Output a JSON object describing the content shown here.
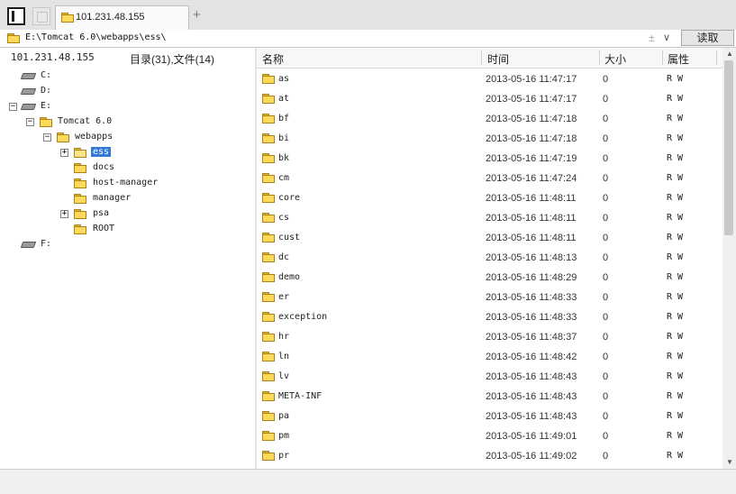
{
  "tabbar": {
    "panel_icon": "panel-toggle-icon",
    "blank_icon": "new-window-icon",
    "active_tab_label": "101.231.48.155",
    "add_tab": "+"
  },
  "address": {
    "path": "E:\\Tomcat 6.0\\webapps\\ess\\",
    "dropdown_glyph": "±",
    "chevron": "∨",
    "read_button": "读取"
  },
  "left": {
    "host": "101.231.48.155",
    "counts": "目录(31),文件(14)",
    "tree": {
      "c": "C:",
      "d": "D:",
      "e": "E:",
      "tomcat": "Tomcat 6.0",
      "webapps": "webapps",
      "ess": "ess",
      "docs": "docs",
      "host_manager": "host-manager",
      "manager": "manager",
      "psa": "psa",
      "root": "ROOT",
      "f": "F:"
    },
    "expand_glyph": "+",
    "collapse_glyph": "−"
  },
  "right": {
    "columns": {
      "name": "名称",
      "time": "时间",
      "size": "大小",
      "attr": "属性"
    },
    "rows": [
      {
        "name": "as",
        "time": "2013-05-16 11:47:17",
        "size": "0",
        "attr": "R W"
      },
      {
        "name": "at",
        "time": "2013-05-16 11:47:17",
        "size": "0",
        "attr": "R W"
      },
      {
        "name": "bf",
        "time": "2013-05-16 11:47:18",
        "size": "0",
        "attr": "R W"
      },
      {
        "name": "bi",
        "time": "2013-05-16 11:47:18",
        "size": "0",
        "attr": "R W"
      },
      {
        "name": "bk",
        "time": "2013-05-16 11:47:19",
        "size": "0",
        "attr": "R W"
      },
      {
        "name": "cm",
        "time": "2013-05-16 11:47:24",
        "size": "0",
        "attr": "R W"
      },
      {
        "name": "core",
        "time": "2013-05-16 11:48:11",
        "size": "0",
        "attr": "R W"
      },
      {
        "name": "cs",
        "time": "2013-05-16 11:48:11",
        "size": "0",
        "attr": "R W"
      },
      {
        "name": "cust",
        "time": "2013-05-16 11:48:11",
        "size": "0",
        "attr": "R W"
      },
      {
        "name": "dc",
        "time": "2013-05-16 11:48:13",
        "size": "0",
        "attr": "R W"
      },
      {
        "name": "demo",
        "time": "2013-05-16 11:48:29",
        "size": "0",
        "attr": "R W"
      },
      {
        "name": "er",
        "time": "2013-05-16 11:48:33",
        "size": "0",
        "attr": "R W"
      },
      {
        "name": "exception",
        "time": "2013-05-16 11:48:33",
        "size": "0",
        "attr": "R W"
      },
      {
        "name": "hr",
        "time": "2013-05-16 11:48:37",
        "size": "0",
        "attr": "R W"
      },
      {
        "name": "ln",
        "time": "2013-05-16 11:48:42",
        "size": "0",
        "attr": "R W"
      },
      {
        "name": "lv",
        "time": "2013-05-16 11:48:43",
        "size": "0",
        "attr": "R W"
      },
      {
        "name": "META-INF",
        "time": "2013-05-16 11:48:43",
        "size": "0",
        "attr": "R W"
      },
      {
        "name": "pa",
        "time": "2013-05-16 11:48:43",
        "size": "0",
        "attr": "R W"
      },
      {
        "name": "pm",
        "time": "2013-05-16 11:49:01",
        "size": "0",
        "attr": "R W"
      },
      {
        "name": "pr",
        "time": "2013-05-16 11:49:02",
        "size": "0",
        "attr": "R W"
      }
    ],
    "scroll_up": "▲",
    "scroll_down": "▼"
  },
  "colors": {
    "selection": "#3478d8",
    "folder": "#ffd95a"
  }
}
